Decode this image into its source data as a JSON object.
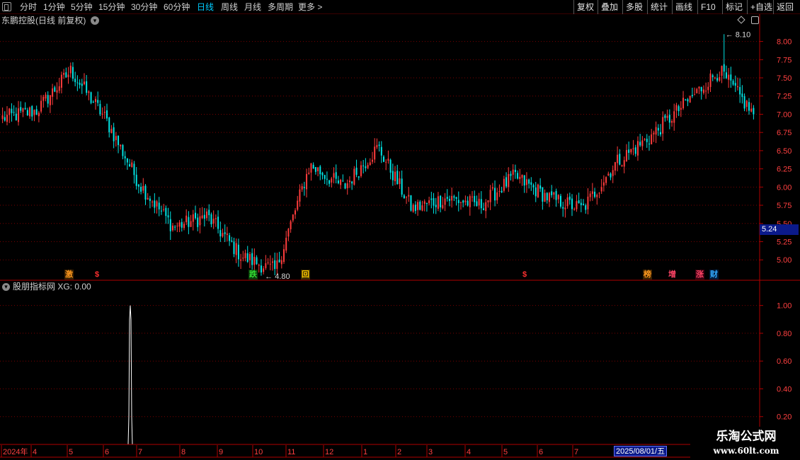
{
  "toolbar": {
    "periods": [
      "分时",
      "1分钟",
      "5分钟",
      "15分钟",
      "30分钟",
      "60分钟",
      "日线",
      "周线",
      "月线",
      "多周期",
      "更多 >"
    ],
    "active_period": "日线",
    "buttons": [
      "复权",
      "叠加",
      "多股",
      "统计",
      "画线",
      "F10",
      "标记",
      "+自选",
      "返回"
    ]
  },
  "main_panel": {
    "title": "东鹏控股(日线 前复权)",
    "high_label": "8.10",
    "low_label": "4.80",
    "current_price_tag": "5.24",
    "markers": [
      {
        "text": "激",
        "color": "#ff9a1f"
      },
      {
        "text": "$",
        "color": "#ff3030"
      },
      {
        "text": "跌",
        "color": "#33dd33"
      },
      {
        "text": "回",
        "color": "#ffcc00"
      },
      {
        "text": "$",
        "color": "#ff3030"
      },
      {
        "text": "榜",
        "color": "#ff9a1f"
      },
      {
        "text": "增",
        "color": "#ff4466"
      },
      {
        "text": "涨",
        "color": "#ff4466"
      },
      {
        "text": "财",
        "color": "#33aaff"
      }
    ]
  },
  "indicator_panel": {
    "title": "股朋指标网  XG: 0.00"
  },
  "date_axis": {
    "labels": [
      "2024年",
      "4",
      "5",
      "6",
      "7",
      "8",
      "9",
      "10",
      "11",
      "12",
      "1",
      "2",
      "3",
      "4",
      "5",
      "6",
      "7"
    ],
    "cursor_date": "2025/08/01/五"
  },
  "watermark": {
    "title": "乐淘公式网",
    "url": "www.60lt.com"
  },
  "chart_data": [
    {
      "type": "candlestick",
      "title": "东鹏控股(日线 前复权)",
      "y_ticks": [
        5.0,
        5.25,
        5.5,
        5.75,
        6.0,
        6.25,
        6.5,
        6.75,
        7.0,
        7.25,
        7.5,
        7.75,
        8.0
      ],
      "ylim": [
        4.72,
        8.2
      ],
      "x_range": [
        "2024-03",
        "2025-08"
      ],
      "grid": "horizontal dotted",
      "colors": {
        "up": "#ff3c3c",
        "down": "#00e4e4",
        "axis": "#b00000",
        "grid": "#7a0000"
      },
      "close_path": [
        {
          "month": "2024-03",
          "close": 6.95
        },
        {
          "month": "2024-04",
          "close": 7.05
        },
        {
          "month": "2024-05",
          "close": 7.6
        },
        {
          "month": "2024-05b",
          "close": 6.95
        },
        {
          "month": "2024-06",
          "close": 6.05
        },
        {
          "month": "2024-07",
          "close": 5.45
        },
        {
          "month": "2024-08",
          "close": 5.6
        },
        {
          "month": "2024-09",
          "close": 5.05
        },
        {
          "month": "2024-09b",
          "close": 4.85
        },
        {
          "month": "2024-10",
          "close": 6.3
        },
        {
          "month": "2024-11",
          "close": 6.0
        },
        {
          "month": "2024-12",
          "close": 6.55
        },
        {
          "month": "2025-01",
          "close": 5.7
        },
        {
          "month": "2025-02",
          "close": 5.85
        },
        {
          "month": "2025-03",
          "close": 5.75
        },
        {
          "month": "2025-04",
          "close": 6.15
        },
        {
          "month": "2025-05",
          "close": 5.85
        },
        {
          "month": "2025-06",
          "close": 5.7
        },
        {
          "month": "2025-07",
          "close": 6.35
        },
        {
          "month": "2025-07b",
          "close": 6.7
        },
        {
          "month": "2025-07c",
          "close": 7.15
        },
        {
          "month": "2025-08",
          "close": 7.6
        },
        {
          "month": "2025-08b",
          "close": 7.0
        }
      ],
      "high": 8.1,
      "low": 4.8,
      "last": 5.24
    },
    {
      "type": "line",
      "series": [
        {
          "name": "XG",
          "values": [
            0,
            0,
            1.0,
            0,
            0
          ]
        }
      ],
      "y_ticks": [
        0.2,
        0.4,
        0.6,
        0.8,
        1.0
      ],
      "ylim": [
        0.0,
        1.09
      ],
      "spike_date": "2024-06"
    }
  ]
}
